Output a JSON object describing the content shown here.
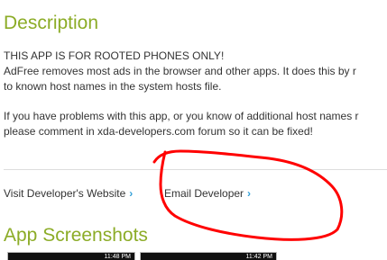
{
  "description": {
    "title": "Description",
    "lines": [
      "THIS APP IS FOR ROOTED PHONES ONLY!",
      "AdFree removes most ads in the browser and other apps. It does this by r",
      "to known host names in the system hosts file.",
      "If you have problems with this app, or you know of additional host names r",
      "please comment in xda-developers.com forum so it can be fixed!"
    ]
  },
  "developer_links": {
    "visit_label": "Visit Developer's Website",
    "email_label": "Email Developer",
    "chevron": "›"
  },
  "screenshots": {
    "title": "App Screenshots",
    "thumb1_time": "11:48 PM",
    "thumb2_time": "11:42 PM"
  },
  "colors": {
    "heading": "#8cac27",
    "link_chevron": "#33a0d8",
    "annotation": "#ff0000"
  }
}
